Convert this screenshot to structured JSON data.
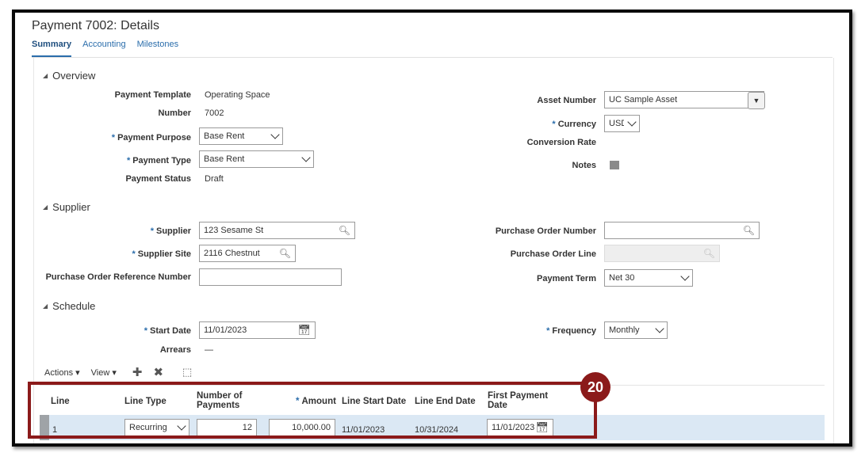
{
  "page_title": "Payment 7002: Details",
  "tabs": [
    {
      "label": "Summary",
      "active": true
    },
    {
      "label": "Accounting"
    },
    {
      "label": "Milestones"
    }
  ],
  "overview": {
    "heading": "Overview",
    "payment_template_label": "Payment Template",
    "payment_template": "Operating Space",
    "number_label": "Number",
    "number": "7002",
    "payment_purpose_label": "Payment Purpose",
    "payment_purpose": "Base Rent",
    "payment_type_label": "Payment Type",
    "payment_type": "Base Rent",
    "payment_status_label": "Payment Status",
    "payment_status": "Draft",
    "asset_number_label": "Asset Number",
    "asset_number": "UC Sample Asset",
    "currency_label": "Currency",
    "currency": "USD",
    "conversion_rate_label": "Conversion Rate",
    "notes_label": "Notes"
  },
  "supplier": {
    "heading": "Supplier",
    "supplier_label": "Supplier",
    "supplier": "123 Sesame St",
    "supplier_site_label": "Supplier Site",
    "supplier_site": "2116 Chestnut",
    "po_reference_label": "Purchase Order Reference Number",
    "po_reference": "",
    "po_number_label": "Purchase Order Number",
    "po_number": "",
    "po_line_label": "Purchase Order Line",
    "po_line": "",
    "payment_term_label": "Payment Term",
    "payment_term": "Net 30"
  },
  "schedule": {
    "heading": "Schedule",
    "start_date_label": "Start Date",
    "start_date": "11/01/2023",
    "arrears_label": "Arrears",
    "arrears": "—",
    "frequency_label": "Frequency",
    "frequency": "Monthly",
    "actions_label": "Actions",
    "view_label": "View"
  },
  "table": {
    "headers": {
      "line": "Line",
      "line_type": "Line Type",
      "num_payments": "Number of Payments",
      "amount": "Amount",
      "line_start": "Line Start Date",
      "line_end": "Line End Date",
      "first_payment": "First Payment Date"
    },
    "rows": [
      {
        "line": "1",
        "line_type": "Recurring",
        "num_payments": "12",
        "amount": "10,000.00",
        "line_start": "11/01/2023",
        "line_end": "10/31/2024",
        "first_payment": "11/01/2023"
      }
    ]
  },
  "callout_number": "20",
  "colors": {
    "accent": "#2a6dab",
    "callout": "#8b1a1a",
    "row_selected": "#dbe8f4"
  }
}
